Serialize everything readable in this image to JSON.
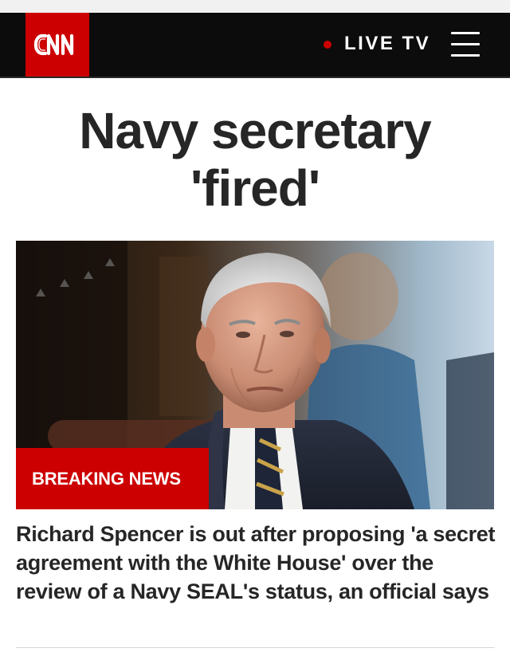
{
  "header": {
    "logo_text": "CNN",
    "live_label": "LIVE TV",
    "menu_icon": "hamburger-menu-icon"
  },
  "colors": {
    "brand_red": "#cc0000",
    "header_bg": "#0c0c0c",
    "text_dark": "#262626"
  },
  "story": {
    "headline_line1": "Navy secretary",
    "headline_line2": "'fired'",
    "badge_label": "BREAKING NEWS",
    "summary": "Richard Spencer is out after proposing 'a secret agreement with the White House' over the review of a Navy SEAL's status, an official says"
  }
}
